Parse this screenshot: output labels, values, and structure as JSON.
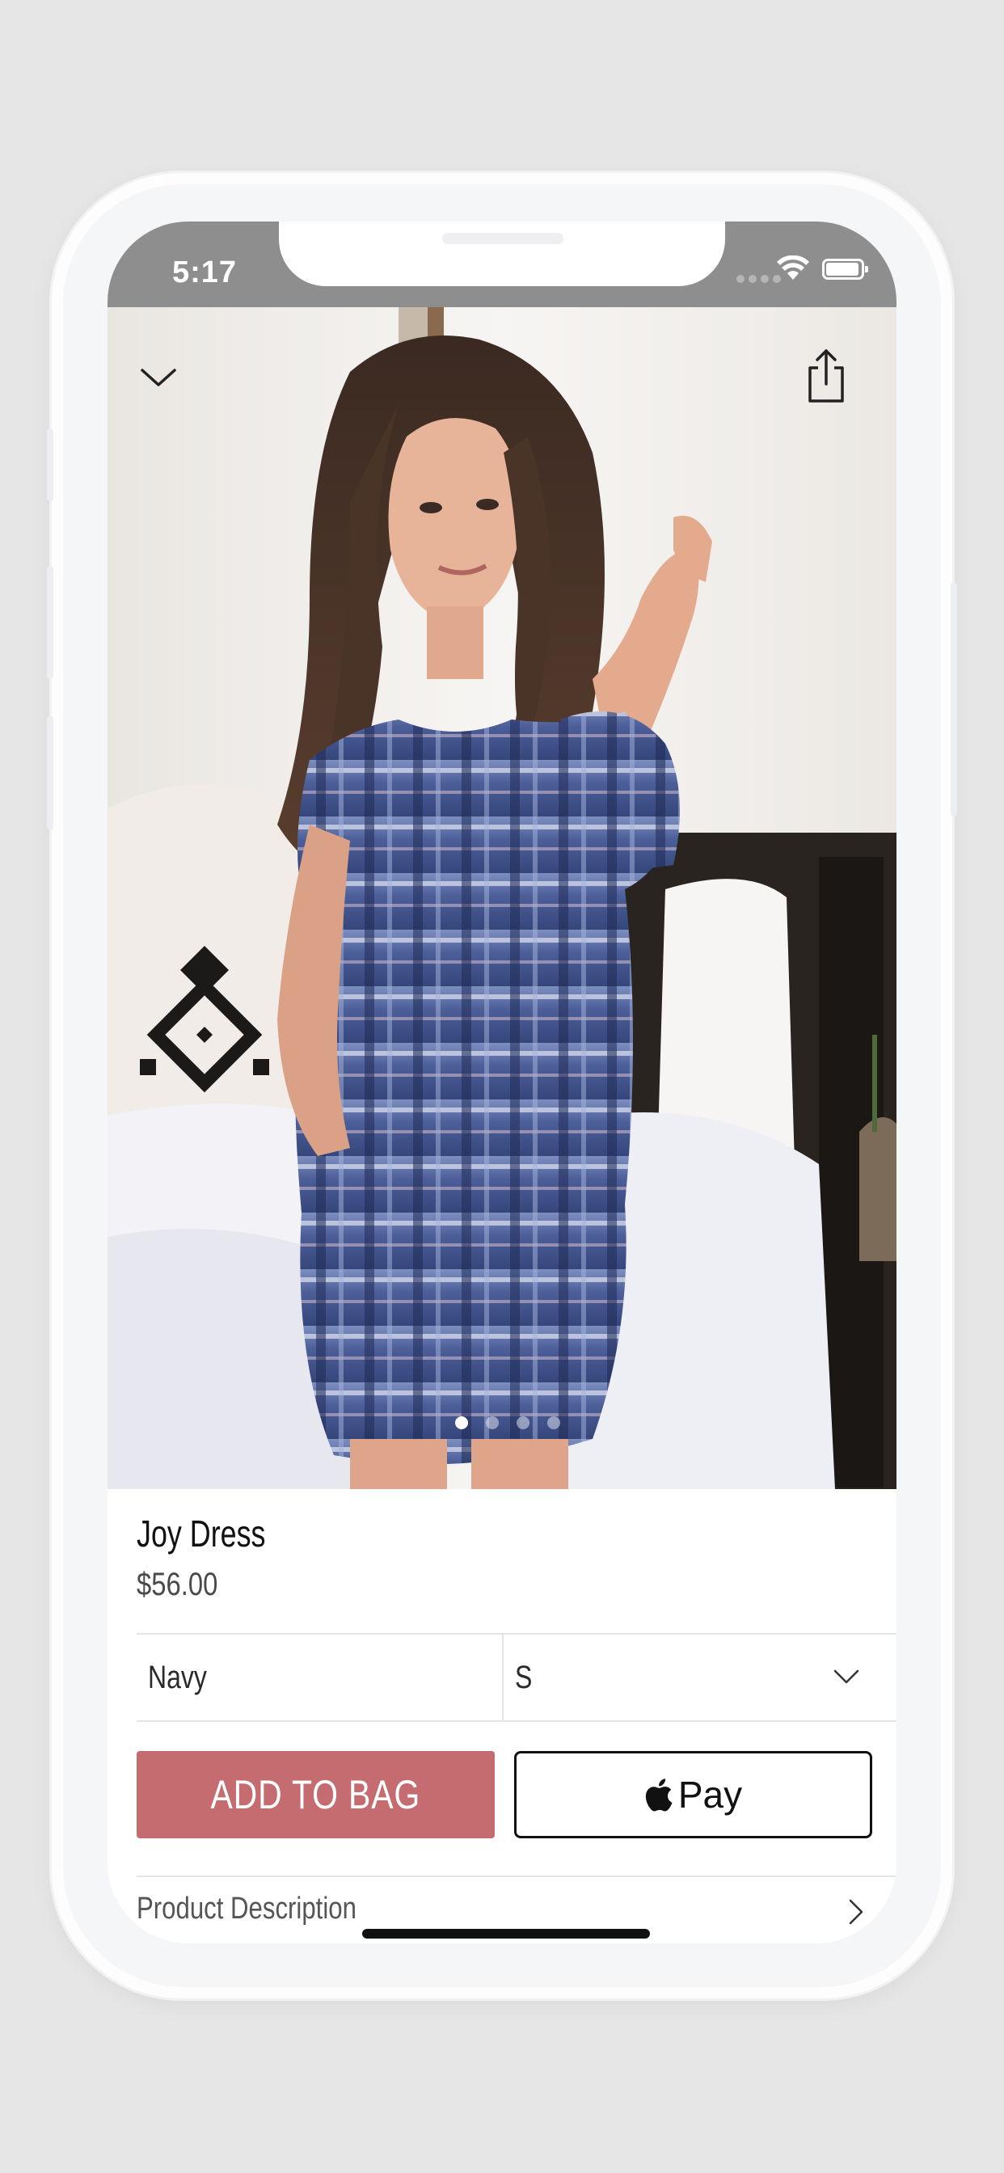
{
  "status_bar": {
    "time": "5:17"
  },
  "product": {
    "name": "Joy Dress",
    "price": "$56.00",
    "image_count": 4,
    "active_image_index": 0
  },
  "selectors": {
    "color": "Navy",
    "size": "S"
  },
  "actions": {
    "add_to_bag_label": "ADD TO BAG",
    "apple_pay_label": "Pay"
  },
  "sections": {
    "product_description_label": "Product Description"
  },
  "icons": {
    "collapse": "chevron-down-icon",
    "share": "share-icon",
    "size_dropdown": "chevron-down-icon",
    "description_arrow": "chevron-right-icon",
    "apple_logo": "apple-logo-icon"
  },
  "colors": {
    "add_to_bag": "#c46c6f",
    "status_bar": "#8e8e8e"
  }
}
